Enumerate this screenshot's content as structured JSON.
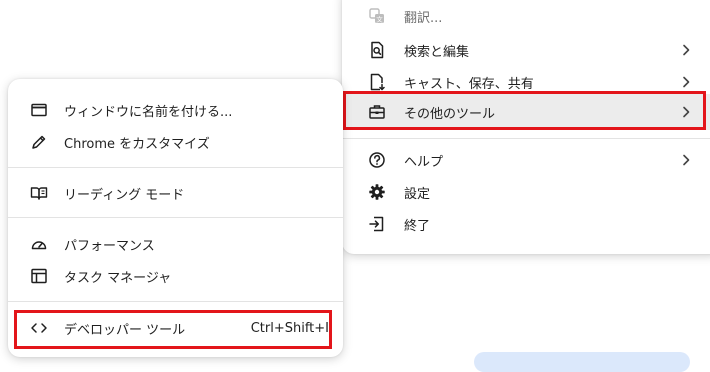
{
  "main_menu": {
    "items": [
      {
        "label": "翻訳...",
        "icon": "translate-icon"
      },
      {
        "label": "検索と編集",
        "icon": "search-edit-icon",
        "has_submenu": true
      },
      {
        "label": "キャスト、保存、共有",
        "icon": "cast-save-share-icon",
        "has_submenu": true
      },
      {
        "label": "その他のツール",
        "icon": "toolbox-icon",
        "has_submenu": true,
        "highlighted": true
      },
      {
        "label": "ヘルプ",
        "icon": "help-icon",
        "has_submenu": true
      },
      {
        "label": "設定",
        "icon": "settings-icon"
      },
      {
        "label": "終了",
        "icon": "exit-icon"
      }
    ]
  },
  "sub_menu": {
    "items": [
      {
        "label": "ウィンドウに名前を付ける...",
        "icon": "window-icon"
      },
      {
        "label": "Chrome をカスタマイズ",
        "icon": "pencil-icon"
      },
      {
        "label": "リーディング モード",
        "icon": "book-icon"
      },
      {
        "label": "パフォーマンス",
        "icon": "gauge-icon"
      },
      {
        "label": "タスク マネージャ",
        "icon": "task-manager-icon"
      },
      {
        "label": "デベロッパー ツール",
        "icon": "code-icon",
        "shortcut": "Ctrl+Shift+I",
        "highlighted": true
      }
    ]
  },
  "colors": {
    "highlight_border": "#e3151a",
    "active_row": "#ececec",
    "divider": "#e3e3e3"
  }
}
